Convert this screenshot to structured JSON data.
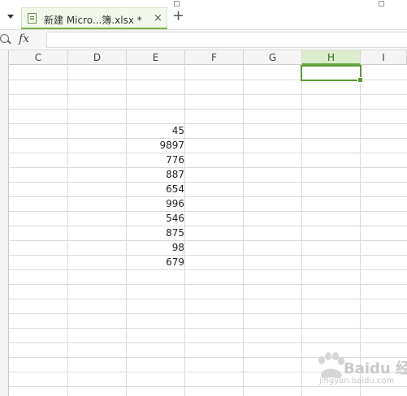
{
  "tabbar": {
    "tab_title": "新建 Micro...簿.xlsx *",
    "close_glyph": "×",
    "new_tab_glyph": "+"
  },
  "formula_bar": {
    "fx_label": "fx",
    "value": ""
  },
  "columns": [
    "C",
    "D",
    "E",
    "F",
    "G",
    "H",
    "I"
  ],
  "active_column": "H",
  "selected_cell": "H1",
  "cells": {
    "E": [
      "",
      "",
      "",
      "",
      "45",
      "9897",
      "776",
      "887",
      "654",
      "996",
      "546",
      "875",
      "98",
      "679"
    ]
  },
  "watermark": {
    "brand_text": "Baidu 经验",
    "url": "jingyan.baidu.com"
  },
  "colors": {
    "accent": "#5a9a32",
    "active_header": "#dceccd"
  }
}
